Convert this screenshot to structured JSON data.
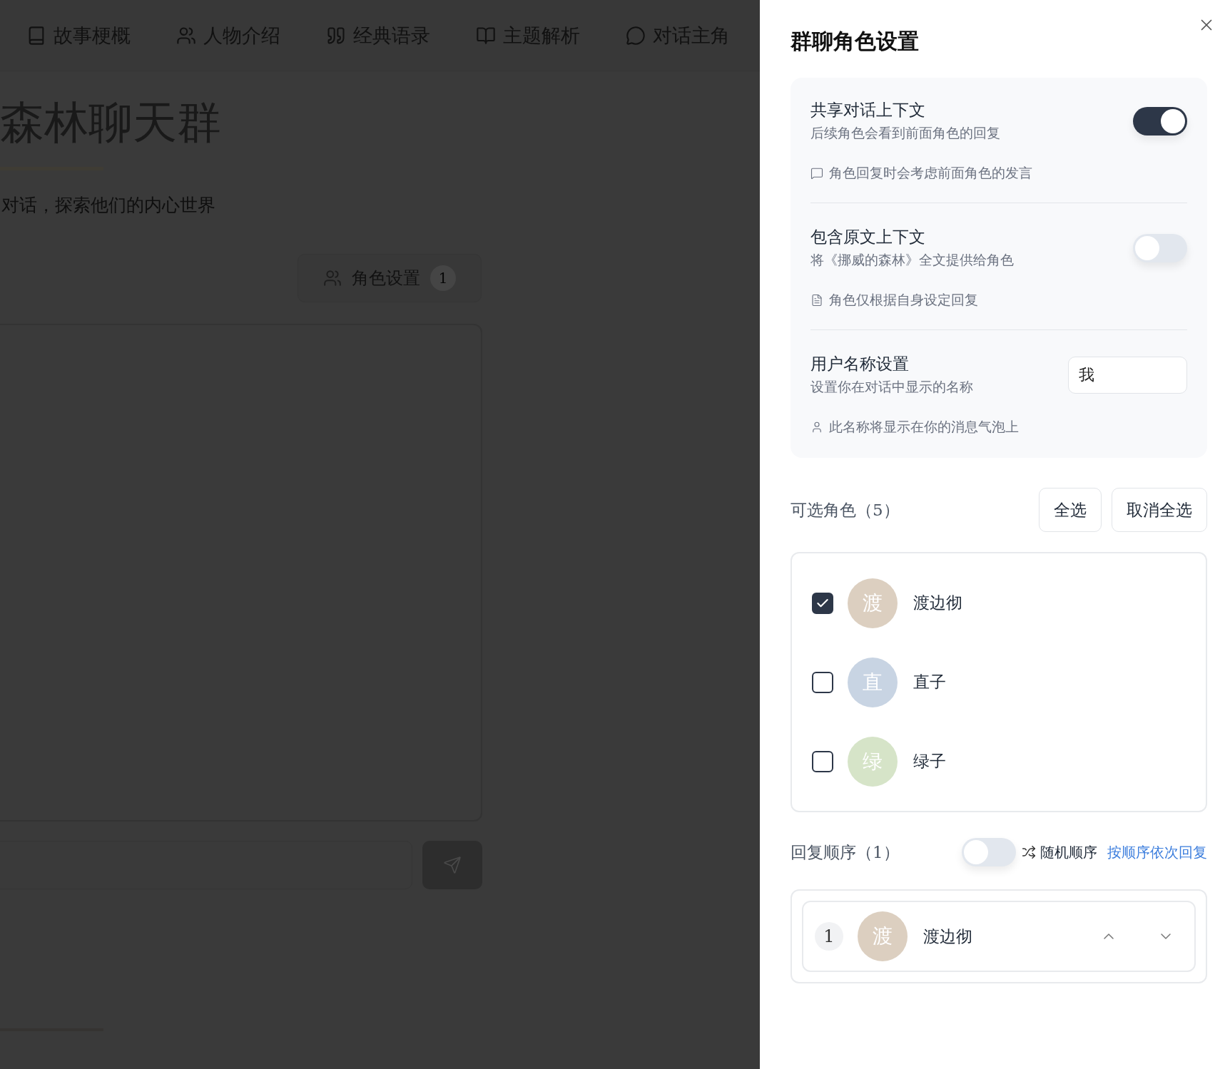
{
  "nav": {
    "items": [
      {
        "label": "故事梗概"
      },
      {
        "label": "人物介绍"
      },
      {
        "label": "经典语录"
      },
      {
        "label": "主题解析"
      },
      {
        "label": "对话主角"
      }
    ]
  },
  "hero": {
    "title": "森林聊天群",
    "subtitle": "对话，探索他们的内心世界"
  },
  "role_button": {
    "label": "角色设置",
    "count": "1"
  },
  "panel": {
    "title": "群聊角色设置",
    "settings": [
      {
        "kind": "toggle",
        "title": "共享对话上下文",
        "description": "后续角色会看到前面角色的回复",
        "on": true,
        "note": "角色回复时会考虑前面角色的发言"
      },
      {
        "kind": "toggle",
        "title": "包含原文上下文",
        "description": "将《挪威的森林》全文提供给角色",
        "on": false,
        "note": "角色仅根据自身设定回复"
      },
      {
        "kind": "input",
        "title": "用户名称设置",
        "description": "设置你在对话中显示的名称",
        "value": "我",
        "note": "此名称将显示在你的消息气泡上"
      }
    ],
    "available": {
      "label": "可选角色（5）",
      "buttons": [
        "全选",
        "取消全选"
      ],
      "characters": [
        {
          "initial": "渡",
          "name": "渡边彻",
          "color": "#dccfc0",
          "checked": true
        },
        {
          "initial": "直",
          "name": "直子",
          "color": "#c8d4e3",
          "checked": false
        },
        {
          "initial": "绿",
          "name": "绿子",
          "color": "#d6e4c8",
          "checked": false
        }
      ]
    },
    "order": {
      "label": "回复顺序（1）",
      "random": {
        "on": false,
        "label": "随机顺序"
      },
      "mode_link": "按顺序依次回复",
      "items": [
        {
          "index": "1",
          "initial": "渡",
          "name": "渡边彻",
          "color": "#dccfc0"
        }
      ]
    }
  }
}
